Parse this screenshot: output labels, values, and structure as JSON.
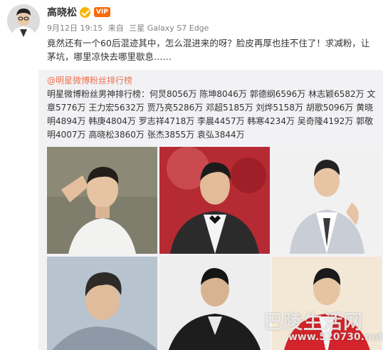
{
  "post": {
    "author": "高晓松",
    "date": "9月12日 19:15",
    "source_prefix": "来自",
    "device": "三星 Galaxy S7 Edge",
    "member_badge_text": "VIP",
    "text": "竟然还有一个60后混迹其中，怎么混进来的呀？脸皮再厚也挂不住了！求减粉，让茅坑，哪里凉快去哪里歇息……"
  },
  "repost": {
    "author": "@明星微博粉丝排行榜",
    "text": "明星微博粉丝男神排行榜：何炅8056万 陈坤8046万 郭德纲6596万 林志颖6582万 文章5776万 王力宏5632万 贾乃亮5286万 邓超5185万 刘烨5158万 胡歌5096万 黄晓明4894万 韩庚4804万 罗志祥4718万 李晨4457万 韩寒4234万 吴奇隆4192万 郭敬明4007万 高晓松3860万 张杰3855万 袁弘3844万"
  },
  "watermark": {
    "title": "巴陵生活网",
    "url": "www.520730.net"
  },
  "colors": {
    "link": "#eb7350",
    "repost_bg": "#f2f2f5",
    "verified": "#f7b500",
    "member": "#f86a0b"
  }
}
